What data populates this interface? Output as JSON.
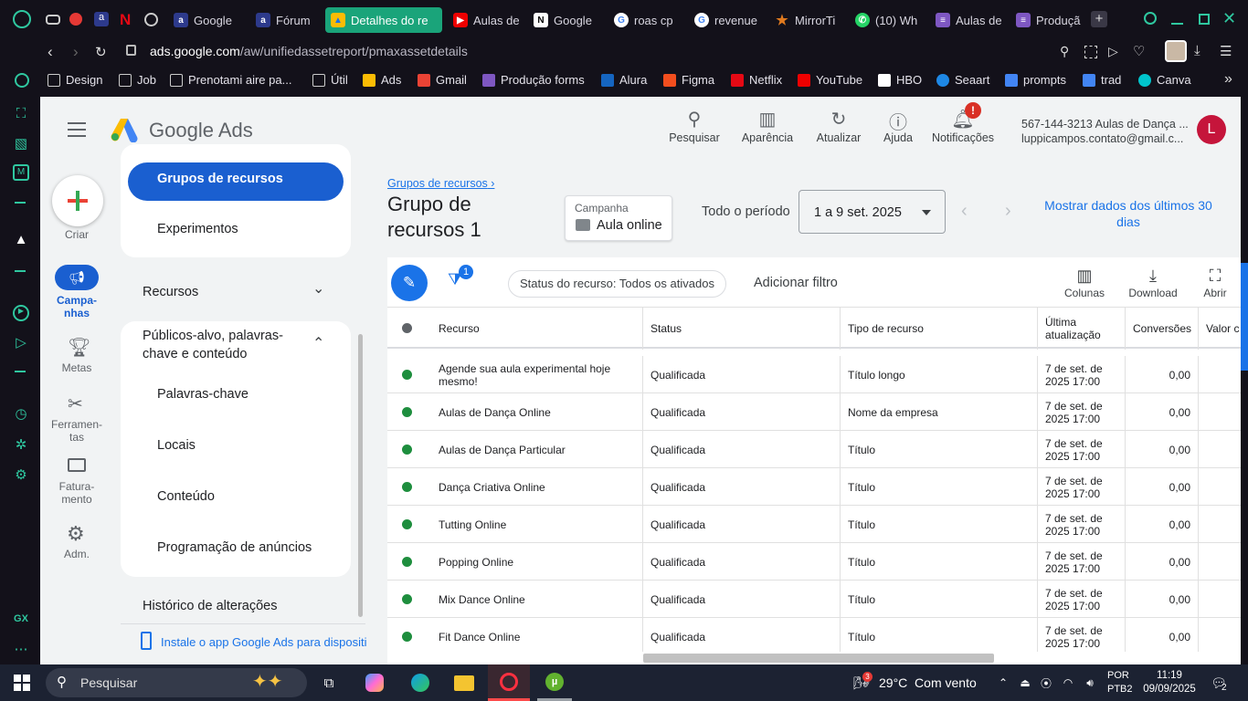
{
  "browser": {
    "tabs": [
      {
        "label": "Google"
      },
      {
        "label": "Fórum"
      },
      {
        "label": "Detalhes do re"
      },
      {
        "label": "Aulas de"
      },
      {
        "label": "Google"
      },
      {
        "label": "roas cp"
      },
      {
        "label": "revenue"
      },
      {
        "label": "MirrorTi"
      },
      {
        "label": "(10) Wh"
      },
      {
        "label": "Aulas de"
      },
      {
        "label": "Produçã"
      }
    ],
    "address_domain": "ads.google.com",
    "address_path": "/aw/unifiedassetreport/pmaxassetdetails",
    "bookmarks": [
      "Design",
      "Job",
      "Prenotami aire pa...",
      "Útil",
      "Ads",
      "Gmail",
      "Produção forms",
      "Alura",
      "Figma",
      "Netflix",
      "YouTube",
      "HBO",
      "Seaart",
      "prompts",
      "trad",
      "Canva"
    ],
    "gx_label": "GX"
  },
  "ads": {
    "brand": "Google Ads",
    "top_buttons": [
      "Pesquisar",
      "Aparência",
      "Atualizar",
      "Ajuda",
      "Notificações"
    ],
    "notif_badge": "!",
    "account_line1": "567-144-3213 Aulas de Dança ...",
    "account_line2": "luppicampos.contato@gmail.c...",
    "avatar": "L",
    "rail": {
      "create": "Criar",
      "campaigns": "Campa-\nnhas",
      "goals": "Metas",
      "tools": "Ferramen-\ntas",
      "billing": "Fatura-\nmento",
      "admin": "Adm."
    },
    "side": {
      "selected": "Grupos de recursos",
      "experiments": "Experimentos",
      "resources": "Recursos",
      "audiences": "Públicos-alvo, palavras-chave e conteúdo",
      "keywords": "Palavras-chave",
      "locations": "Locais",
      "content": "Conteúdo",
      "scheduling": "Programação de anúncios",
      "history": "Histórico de alterações",
      "install": "Instale o app Google Ads para dispositi"
    },
    "breadcrumb": "Grupos de recursos",
    "title": "Grupo de recursos 1",
    "campaign_label": "Campanha",
    "campaign_name": "Aula online",
    "period_label": "Todo o período",
    "date_range": "1 a 9 set. 2025",
    "show_last": "Mostrar dados dos últimos 30 dias",
    "filter_badge": "1",
    "filter_chip": "Status do recurso: Todos os ativados",
    "add_filter": "Adicionar filtro",
    "toolbar": [
      "Colunas",
      "Download",
      "Abrir"
    ],
    "columns": [
      "Recurso",
      "Status",
      "Tipo de recurso",
      "Última atualização",
      "Conversões",
      "Valor c"
    ],
    "rows": [
      {
        "resource": "Agende sua aula experimental hoje mesmo!",
        "status": "Qualificada",
        "type": "Título longo",
        "updated": "7 de set. de 2025 17:00",
        "conv": "0,00"
      },
      {
        "resource": "Aulas de Dança Online",
        "status": "Qualificada",
        "type": "Nome da empresa",
        "updated": "7 de set. de 2025 17:00",
        "conv": "0,00"
      },
      {
        "resource": "Aulas de Dança Particular",
        "status": "Qualificada",
        "type": "Título",
        "updated": "7 de set. de 2025 17:00",
        "conv": "0,00"
      },
      {
        "resource": "Dança Criativa Online",
        "status": "Qualificada",
        "type": "Título",
        "updated": "7 de set. de 2025 17:00",
        "conv": "0,00"
      },
      {
        "resource": "Tutting Online",
        "status": "Qualificada",
        "type": "Título",
        "updated": "7 de set. de 2025 17:00",
        "conv": "0,00"
      },
      {
        "resource": "Popping Online",
        "status": "Qualificada",
        "type": "Título",
        "updated": "7 de set. de 2025 17:00",
        "conv": "0,00"
      },
      {
        "resource": "Mix Dance Online",
        "status": "Qualificada",
        "type": "Título",
        "updated": "7 de set. de 2025 17:00",
        "conv": "0,00"
      },
      {
        "resource": "Fit Dance Online",
        "status": "Qualificada",
        "type": "Título",
        "updated": "7 de set. de 2025 17:00",
        "conv": "0,00"
      }
    ]
  },
  "taskbar": {
    "search": "Pesquisar",
    "weather_badge": "3",
    "weather": "29°C  Com vento",
    "lang1": "POR",
    "lang2": "PTB2",
    "time": "11:19",
    "date": "09/09/2025",
    "notif": "2"
  },
  "colors": {
    "accent": "#1a73e8",
    "selected_nav": "#1a5fd0",
    "status_green": "#1e8e3e",
    "tab_active": "#1aa47a"
  }
}
